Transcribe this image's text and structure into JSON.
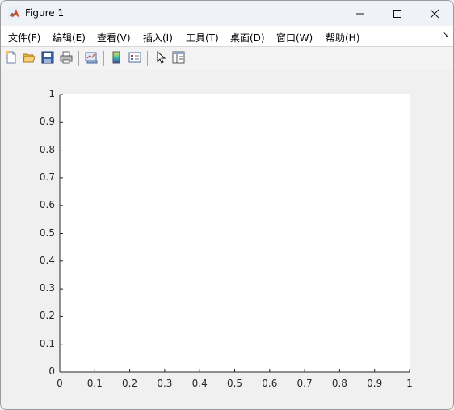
{
  "window": {
    "title": "Figure 1"
  },
  "menu": {
    "items": [
      "文件(F)",
      "编辑(E)",
      "查看(V)",
      "插入(I)",
      "工具(T)",
      "桌面(D)",
      "窗口(W)",
      "帮助(H)"
    ]
  },
  "toolbar": {
    "icons": [
      "new-figure-icon",
      "open-file-icon",
      "save-icon",
      "print-icon",
      "link-plot-icon",
      "insert-colorbar-icon",
      "insert-legend-icon",
      "edit-plot-icon",
      "property-inspector-icon"
    ]
  },
  "chart_data": {
    "type": "line",
    "series": [],
    "xlim": [
      0,
      1
    ],
    "ylim": [
      0,
      1
    ],
    "xticks": [
      "0",
      "0.1",
      "0.2",
      "0.3",
      "0.4",
      "0.5",
      "0.6",
      "0.7",
      "0.8",
      "0.9",
      "1"
    ],
    "yticks": [
      "0",
      "0.1",
      "0.2",
      "0.3",
      "0.4",
      "0.5",
      "0.6",
      "0.7",
      "0.8",
      "0.9",
      "1"
    ],
    "grid": false
  }
}
